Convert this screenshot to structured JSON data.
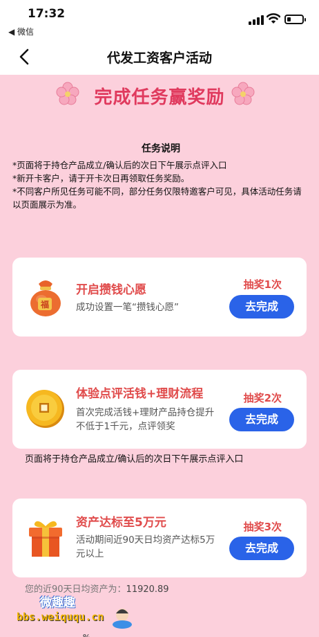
{
  "status_bar": {
    "time": "17:32",
    "back_app": "◀ 微信"
  },
  "nav": {
    "title": "代发工资客户活动"
  },
  "banner": {
    "title": "完成任务赢奖励"
  },
  "rules": {
    "title": "任务说明",
    "lines": [
      "*页面将于持仓产品成立/确认后的次日下午展示点评入口",
      "*新开卡客户，请于开卡次日再领取任务奖励。",
      "*不同客户所见任务可能不同，部分任务仅限特邀客户可见，具体活动任务请以页面展示为准。"
    ]
  },
  "tasks": [
    {
      "title": "开启攒钱心愿",
      "desc": "成功设置一笔“攒钱心愿”",
      "lottery": "抽奖1次",
      "button": "去完成",
      "icon": "lucky-bag-icon",
      "icon_char": "福"
    },
    {
      "title": "体验点评活钱+理财流程",
      "desc": "首次完成活钱+理财产品持仓提升不低于1千元，点评领奖",
      "lottery": "抽奖2次",
      "button": "去完成",
      "icon": "gold-coin-icon"
    },
    {
      "title": "资产达标至5万元",
      "desc": "活动期间近90天日均资产达标5万元以上",
      "lottery": "抽奖3次",
      "button": "去完成",
      "icon": "gift-box-icon"
    }
  ],
  "mid_note": "页面将于持仓产品成立/确认后的次日下午展示点评入口",
  "assets": {
    "label": "您的近90天日均资产为：",
    "value": "11920.89"
  },
  "watermark": {
    "name": "微趣趣",
    "url": "bbs.weiququ.cn",
    "tail": "%"
  },
  "colors": {
    "page_bg": "#fcd0dc",
    "accent_red": "#e04b4b",
    "button_blue": "#2a63e8",
    "banner_red": "#e03a5e"
  }
}
